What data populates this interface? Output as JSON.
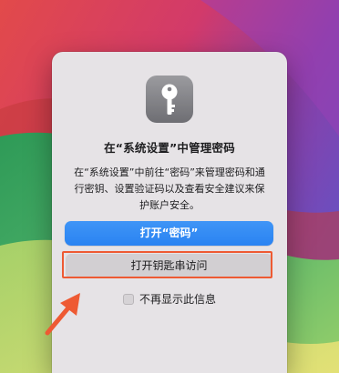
{
  "dialog": {
    "title": "在“系统设置”中管理密码",
    "message": "在“系统设置”中前往“密码”来管理密码和通行密钥、设置验证码以及查看安全建议来保护账户安全。",
    "primary_button_label": "打开“密码”",
    "secondary_button_label": "打开钥匙串访问",
    "checkbox_label": "不再显示此信息",
    "checkbox_checked": false,
    "icon": "key-icon"
  },
  "annotation": {
    "highlight_color": "#ee5a33",
    "arrow_color": "#ee5a33"
  },
  "colors": {
    "primary_button": "#2a83f2",
    "dialog_background": "#e6e3e6"
  }
}
